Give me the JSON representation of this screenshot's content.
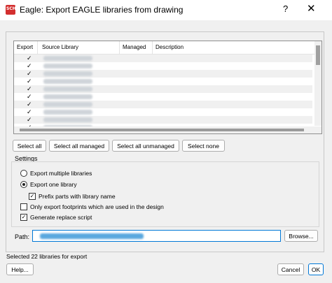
{
  "window": {
    "title": "Eagle: Export EAGLE libraries from drawing",
    "help_glyph": "?",
    "close_glyph": "✕",
    "app_icon_text": "SCH",
    "app_icon_color": "#d32f2f"
  },
  "table": {
    "columns": [
      "Export",
      "Source Library",
      "Managed",
      "Description"
    ],
    "check_glyph": "✓",
    "row_count": 11,
    "partial_text": "...500"
  },
  "buttons": {
    "select_all": "Select all",
    "select_all_managed": "Select all managed",
    "select_all_unmanaged": "Select all unmanaged",
    "select_none": "Select none",
    "browse": "Browse...",
    "help": "Help...",
    "cancel": "Cancel",
    "ok": "OK"
  },
  "settings": {
    "label": "Settings",
    "export_multiple": "Export multiple libraries",
    "export_one": "Export one library",
    "prefix_parts": "Prefix parts with library name",
    "only_used": "Only export footprints which are used in the design",
    "gen_replace": "Generate replace script",
    "selected_option": "export_one",
    "prefix_checked": true,
    "only_used_checked": false,
    "gen_replace_checked": true
  },
  "path": {
    "label": "Path:"
  },
  "status": "Selected 22 libraries for export",
  "accent_color": "#0078d7"
}
